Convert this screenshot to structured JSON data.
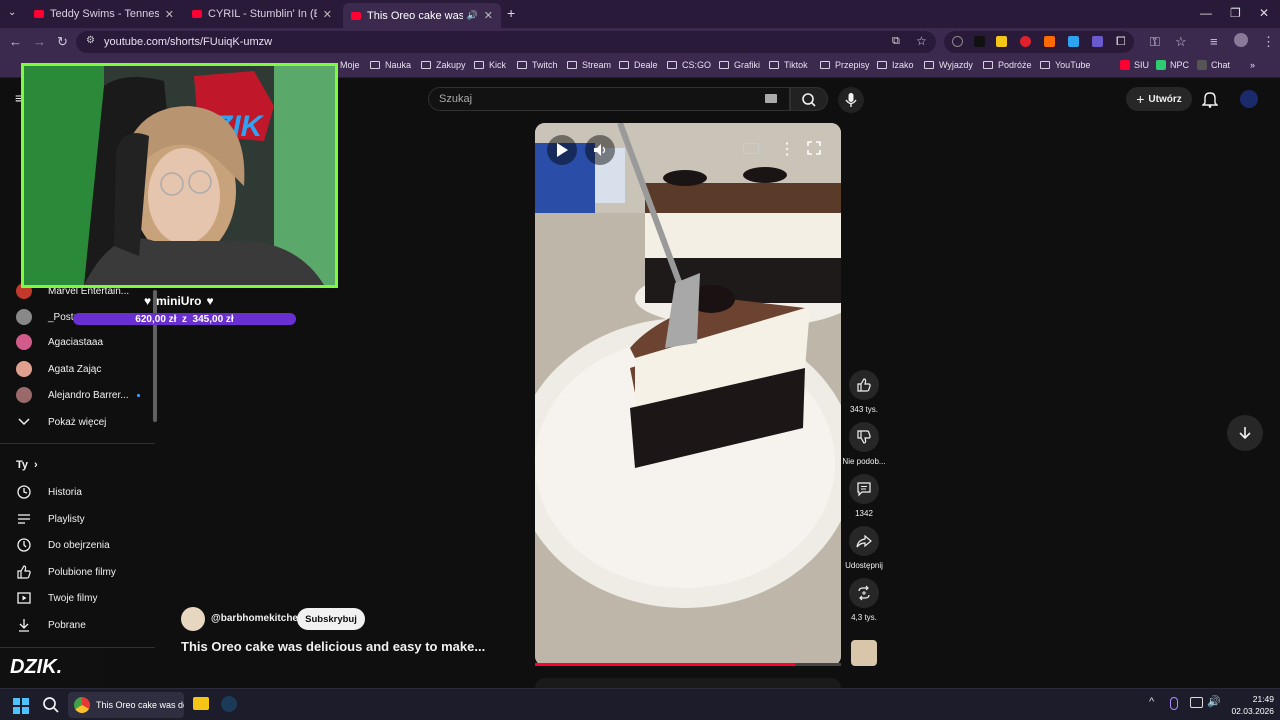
{
  "browser": {
    "tabs": [
      {
        "label": "Teddy Swims - Tennessee Whis",
        "active": false
      },
      {
        "label": "CYRIL - Stumblin' In (Extended",
        "active": false
      },
      {
        "label": "This Oreo cake was deliciou",
        "active": true
      }
    ],
    "new_tab_label": "+",
    "url": "youtube.com/shorts/FUuiqK-umzw",
    "bookmarks": [
      "Moje",
      "Nauka",
      "Zakupy",
      "Kick",
      "Twitch",
      "Stream",
      "Deale",
      "CS:GO",
      "Grafiki",
      "Tiktok",
      "Przepisy",
      "Izako",
      "Wyjazdy",
      "Podróże",
      "YouTube",
      "SIU",
      "NPC",
      "Chat"
    ]
  },
  "youtube": {
    "search_placeholder": "Szukaj",
    "create_label": "Utwórz",
    "sidebar": {
      "subscriptions": [
        {
          "label": "Marvel Entertain...",
          "color": "#c0392b"
        },
        {
          "label": "_Postu",
          "color": "#888888"
        },
        {
          "label": "Agaciastaaa",
          "color": "#d15b8a"
        },
        {
          "label": "Agata Zając",
          "color": "#e0a090"
        },
        {
          "label": "Alejandro Barrer...",
          "color": "#9a6a6a"
        }
      ],
      "show_more": "Pokaż więcej",
      "you_header": "Ty",
      "you_items": [
        "Historia",
        "Playlisty",
        "Do obejrzenia",
        "Polubione filmy",
        "Twoje filmy",
        "Pobrane"
      ]
    },
    "short": {
      "channel": "@barbhomekitchen",
      "subscribe_label": "Subskrybuj",
      "title": "This Oreo cake was delicious and  easy to make...",
      "progress": 0.85,
      "actions": [
        {
          "name": "like",
          "label": "343 tys."
        },
        {
          "name": "dislike",
          "label": "Nie podob..."
        },
        {
          "name": "comments",
          "label": "1342"
        },
        {
          "name": "share",
          "label": "Udostępnij"
        },
        {
          "name": "remix",
          "label": "4,3 tys."
        }
      ]
    }
  },
  "overlay": {
    "streamer_name": "miniUro",
    "goal_text": "620,00 zł  z  345,00 zł",
    "logo_text": "DZIK",
    "logo_bottom": "DZIK."
  },
  "taskbar": {
    "active_app_label": "This Oreo cake was deli",
    "time": "21:49",
    "date": "02.03.2026"
  },
  "colors": {
    "brand_red": "#ff0033",
    "overlay_green": "#7cfc3c",
    "goal_purple": "#6a2fd0"
  }
}
